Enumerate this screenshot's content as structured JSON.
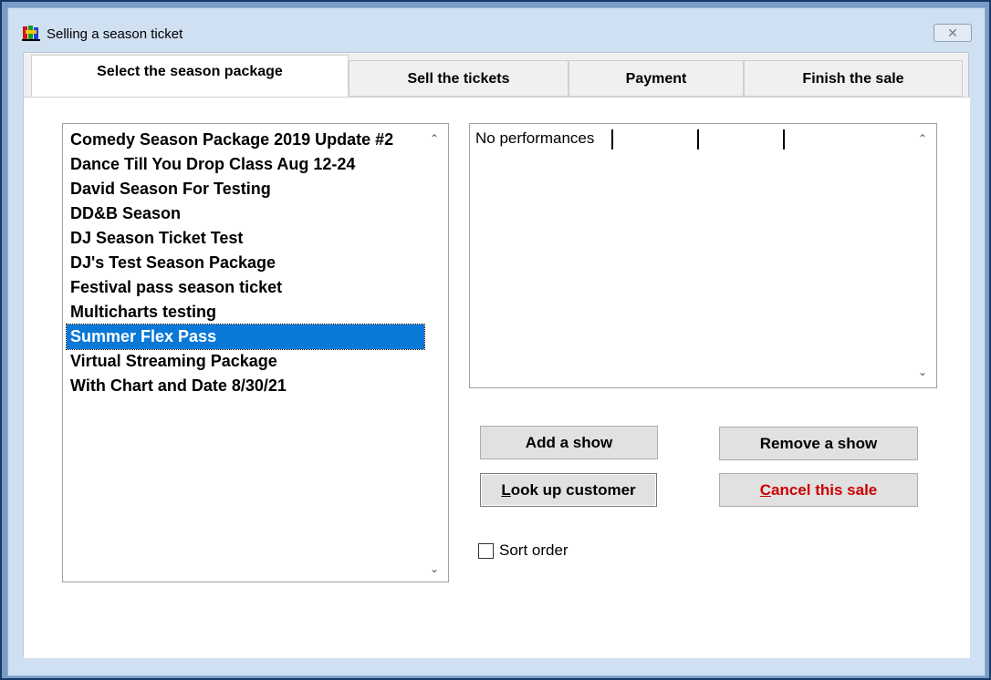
{
  "window": {
    "title": "Selling a season ticket",
    "close_label": "✕"
  },
  "tabs": [
    {
      "label": "Select the season package",
      "active": true
    },
    {
      "label": "Sell the tickets",
      "active": false
    },
    {
      "label": "Payment",
      "active": false
    },
    {
      "label": "Finish the sale",
      "active": false
    }
  ],
  "packages": {
    "items": [
      "Comedy Season Package 2019 Update #2",
      "Dance Till You Drop Class Aug 12-24",
      "David Season For Testing",
      "DD&B Season",
      "DJ Season Ticket Test",
      "DJ's Test Season Package",
      "Festival pass season ticket",
      "Multicharts testing",
      "Summer Flex Pass",
      "Virtual Streaming Package",
      "With Chart and Date 8/30/21"
    ],
    "selected": "Summer Flex Pass"
  },
  "performances": {
    "text": "No performances"
  },
  "buttons": {
    "add_show": "Add a show",
    "remove_show": "Remove a show",
    "lookup_customer_prefix": "L",
    "lookup_customer_rest": "ook up customer",
    "cancel_sale_prefix": "C",
    "cancel_sale_rest": "ancel this sale"
  },
  "sort_order": {
    "label": "Sort order",
    "checked": false
  },
  "colors": {
    "selection": "#0a78d7",
    "cancel_text": "#cc0000"
  }
}
